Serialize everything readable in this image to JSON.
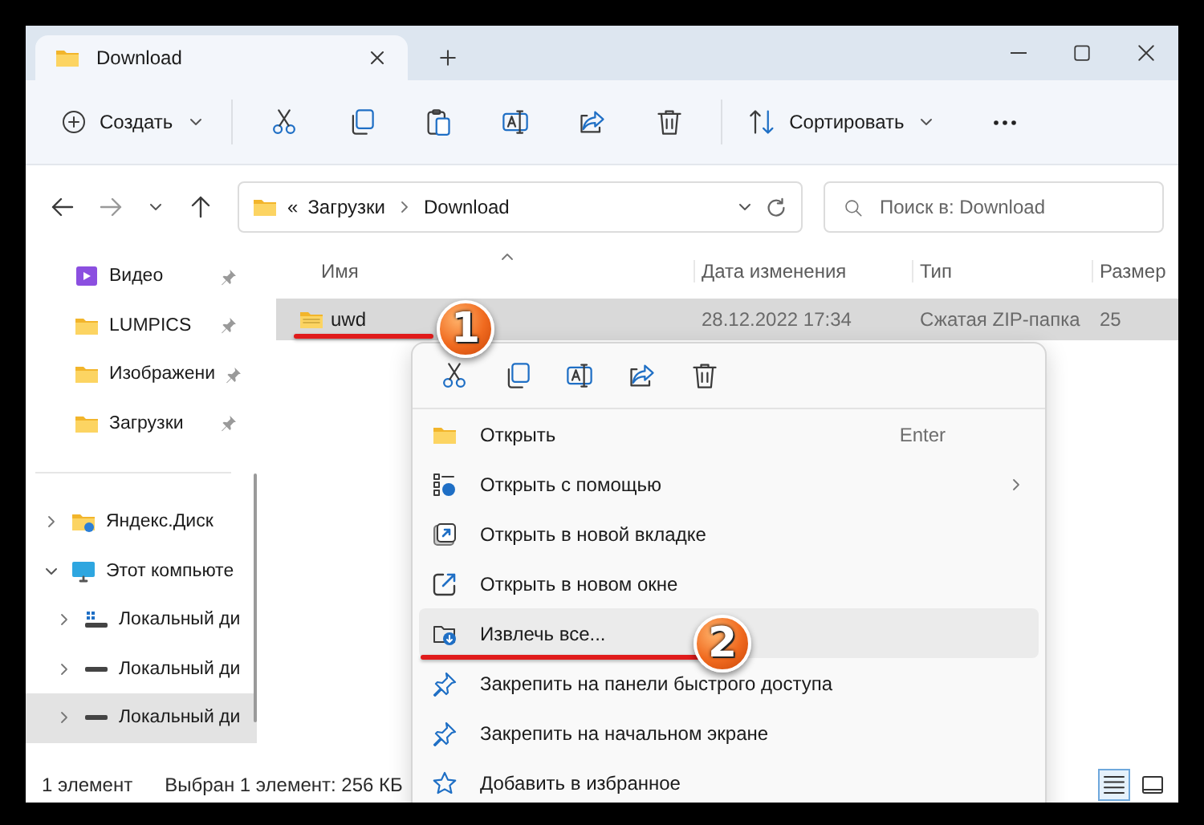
{
  "window": {
    "tab": {
      "title": "Download",
      "selected": true
    }
  },
  "toolbar": {
    "create": "Создать",
    "sort": "Сортировать"
  },
  "address": {
    "overflow": "«",
    "path": [
      "Загрузки",
      "Download"
    ],
    "search_placeholder": "Поиск в: Download"
  },
  "sidebar": {
    "pinned": [
      {
        "label": "Видео",
        "kind": "video"
      },
      {
        "label": "LUMPICS",
        "kind": "folder"
      },
      {
        "label": "Изображени",
        "kind": "folder"
      },
      {
        "label": "Загрузки",
        "kind": "folder"
      }
    ],
    "tree": [
      {
        "label": "Яндекс.Диск",
        "kind": "cloud",
        "expanded": false,
        "selected": false
      },
      {
        "label": "Этот компьюте",
        "kind": "computer",
        "expanded": true,
        "selected": false,
        "children": [
          {
            "label": "Локальный ди",
            "kind": "system-drive",
            "expanded": false,
            "selected": false
          },
          {
            "label": "Локальный ди",
            "kind": "drive",
            "expanded": false,
            "selected": false
          },
          {
            "label": "Локальный ди",
            "kind": "drive",
            "expanded": false,
            "selected": true
          }
        ]
      }
    ]
  },
  "files": {
    "columns": [
      "Имя",
      "Дата изменения",
      "Тип",
      "Размер"
    ],
    "rows": [
      {
        "name": "uwd",
        "date": "28.12.2022 17:34",
        "type": "Сжатая ZIP-папка",
        "size": "25",
        "selected": true
      }
    ]
  },
  "context_menu": {
    "items": [
      {
        "label": "Открыть",
        "kind": "open",
        "shortcut": "Enter",
        "selected": false
      },
      {
        "label": "Открыть с помощью",
        "kind": "open-with",
        "submenu": true,
        "selected": false
      },
      {
        "label": "Открыть в новой вкладке",
        "kind": "new-tab",
        "selected": false
      },
      {
        "label": "Открыть в новом окне",
        "kind": "new-window",
        "selected": false
      },
      {
        "label": "Извлечь все...",
        "kind": "extract",
        "selected": true
      },
      {
        "label": "Закрепить на панели быстрого доступа",
        "kind": "pin",
        "selected": false
      },
      {
        "label": "Закрепить на начальном экране",
        "kind": "pin",
        "selected": false
      },
      {
        "label": "Добавить в избранное",
        "kind": "star",
        "selected": false
      }
    ]
  },
  "callouts": [
    {
      "number": "1"
    },
    {
      "number": "2"
    }
  ],
  "status_bar": {
    "count": "1 элемент",
    "selection": "Выбран 1 элемент: 256 КБ",
    "views": [
      {
        "selected": true
      },
      {
        "selected": false
      }
    ]
  }
}
